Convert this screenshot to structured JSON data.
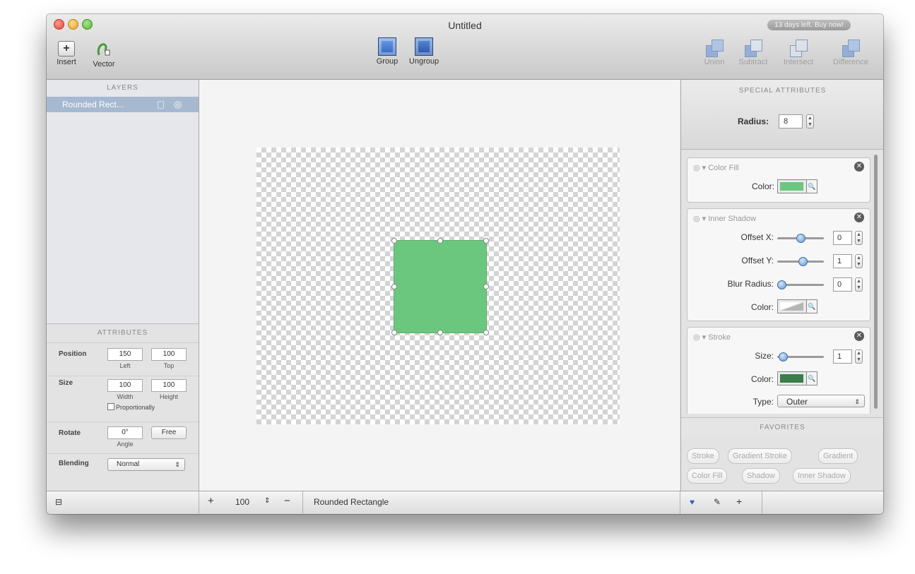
{
  "window": {
    "title": "Untitled",
    "trial_badge": "13 days left. Buy now!"
  },
  "toolbar": {
    "insert_label": "Insert",
    "vector_label": "Vector",
    "group_label": "Group",
    "ungroup_label": "Ungroup",
    "union_label": "Union",
    "subtract_label": "Subtract",
    "intersect_label": "Intersect",
    "difference_label": "Difference"
  },
  "layers": {
    "header": "LAYERS",
    "items": [
      {
        "label": "Rounded Rect..."
      }
    ]
  },
  "attributes": {
    "header": "ATTRIBUTES",
    "position_label": "Position",
    "left_value": "150",
    "top_value": "100",
    "left_caption": "Left",
    "top_caption": "Top",
    "size_label": "Size",
    "width_value": "100",
    "height_value": "100",
    "width_caption": "Width",
    "height_caption": "Height",
    "proportionally_label": "Proportionally",
    "rotate_label": "Rotate",
    "angle_value": "0°",
    "free_label": "Free",
    "angle_caption": "Angle",
    "blending_label": "Blending",
    "blending_value": "Normal"
  },
  "special_attributes": {
    "header": "SPECIAL ATTRIBUTES",
    "radius_label": "Radius:",
    "radius_value": "8"
  },
  "effects": {
    "color_fill": {
      "title": "Color Fill",
      "color_label": "Color:",
      "color": "#6cc77e"
    },
    "inner_shadow": {
      "title": "Inner Shadow",
      "offset_x_label": "Offset X:",
      "offset_x_value": "0",
      "offset_y_label": "Offset Y:",
      "offset_y_value": "1",
      "blur_label": "Blur Radius:",
      "blur_value": "0",
      "color_label": "Color:"
    },
    "stroke": {
      "title": "Stroke",
      "size_label": "Size:",
      "size_value": "1",
      "color_label": "Color:",
      "color": "#3a7d4a",
      "type_label": "Type:",
      "type_value": "Outer"
    }
  },
  "favorites": {
    "header": "FAVORITES",
    "items": [
      "Stroke",
      "Gradient Stroke",
      "Gradient",
      "Color Fill",
      "Shadow",
      "Inner Shadow"
    ]
  },
  "bottom": {
    "zoom": "100",
    "selection_name": "Rounded Rectangle"
  }
}
